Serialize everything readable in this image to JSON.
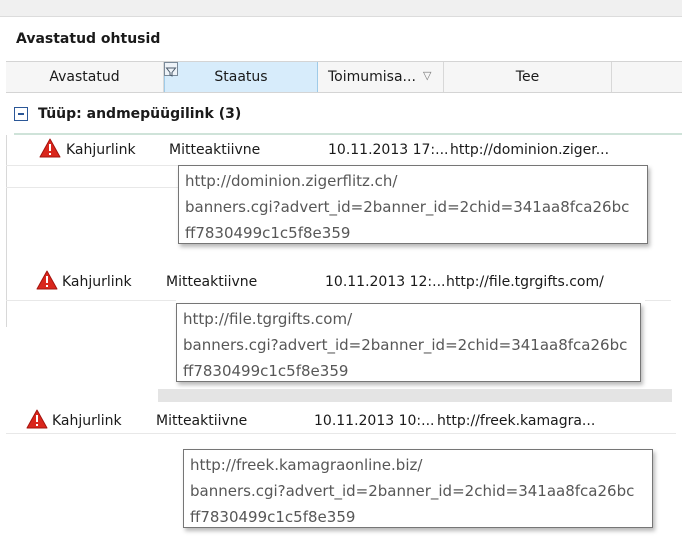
{
  "panel": {
    "title": "Avastatud ohtusid"
  },
  "columns": [
    {
      "label": "Avastatud"
    },
    {
      "label": "Staatus"
    },
    {
      "label": "Toimumisa..."
    },
    {
      "label": "Tee"
    }
  ],
  "group": {
    "label": "Tüüp: andmepüügilink (3)"
  },
  "rows": [
    {
      "type": "Kahjurlink",
      "status": "Mitteaktiivne",
      "time": "10.11.2013 17:...",
      "path": "http://dominion.ziger...",
      "tooltip": [
        "http://dominion.zigerflitz.ch/",
        "banners.cgi?advert_id=2banner_id=2chid=341aa8fca26bc",
        "ff7830499c1c5f8e359"
      ]
    },
    {
      "type": "Kahjurlink",
      "status": "Mitteaktiivne",
      "time": "10.11.2013 12:...",
      "path": "http://file.tgrgifts.com/",
      "tooltip": [
        "http://file.tgrgifts.com/",
        "banners.cgi?advert_id=2banner_id=2chid=341aa8fca26bc",
        "ff7830499c1c5f8e359"
      ]
    },
    {
      "type": "Kahjurlink",
      "status": "Mitteaktiivne",
      "time": "10.11.2013 10:...",
      "path": "http://freek.kamagra...",
      "tooltip": [
        "http://freek.kamagraonline.biz/",
        "banners.cgi?advert_id=2banner_id=2chid=341aa8fca26bc",
        "ff7830499c1c5f8e359"
      ]
    }
  ],
  "colors": {
    "header_selected": "#d7ecfb",
    "warning": "#d9261c",
    "tooltip_text": "#575757"
  },
  "icons": {
    "status": "warning-icon",
    "group_toggle": "collapse-minus-icon",
    "column_filter": "filter-icon",
    "sort": "sort-desc-icon"
  }
}
